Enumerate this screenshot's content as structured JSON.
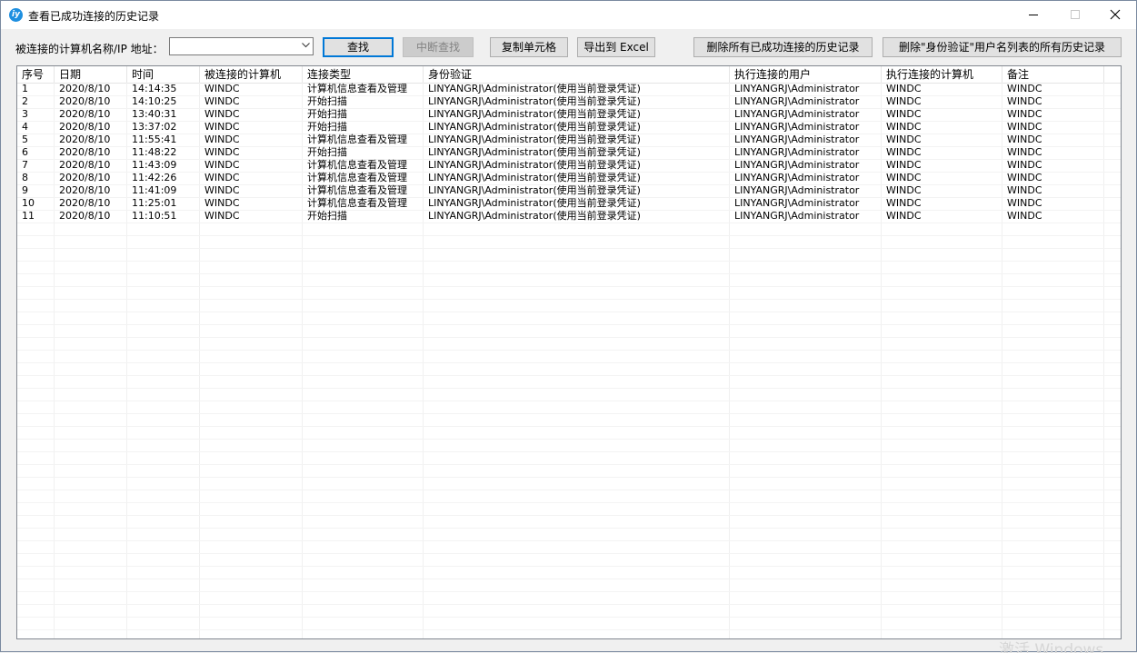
{
  "window": {
    "title": "查看已成功连接的历史记录",
    "icon_glyph": "iy"
  },
  "toolbar": {
    "host_label": "被连接的计算机名称/IP 地址：",
    "host_value": "",
    "search_label": "查找",
    "stop_label": "中断查找",
    "copy_label": "复制单元格",
    "export_label": "导出到 Excel",
    "delete_all_label": "删除所有已成功连接的历史记录",
    "delete_auth_label": "删除\"身份验证\"用户名列表的所有历史记录"
  },
  "grid": {
    "columns": [
      "序号",
      "日期",
      "时间",
      "被连接的计算机",
      "连接类型",
      "身份验证",
      "执行连接的用户",
      "执行连接的计算机",
      "备注"
    ],
    "rows": [
      [
        "1",
        "2020/8/10",
        "14:14:35",
        "WINDC",
        "计算机信息查看及管理",
        "LINYANGRJ\\Administrator(使用当前登录凭证)",
        "LINYANGRJ\\Administrator",
        "WINDC",
        "WINDC"
      ],
      [
        "2",
        "2020/8/10",
        "14:10:25",
        "WINDC",
        "开始扫描",
        "LINYANGRJ\\Administrator(使用当前登录凭证)",
        "LINYANGRJ\\Administrator",
        "WINDC",
        "WINDC"
      ],
      [
        "3",
        "2020/8/10",
        "13:40:31",
        "WINDC",
        "开始扫描",
        "LINYANGRJ\\Administrator(使用当前登录凭证)",
        "LINYANGRJ\\Administrator",
        "WINDC",
        "WINDC"
      ],
      [
        "4",
        "2020/8/10",
        "13:37:02",
        "WINDC",
        "开始扫描",
        "LINYANGRJ\\Administrator(使用当前登录凭证)",
        "LINYANGRJ\\Administrator",
        "WINDC",
        "WINDC"
      ],
      [
        "5",
        "2020/8/10",
        "11:55:41",
        "WINDC",
        "计算机信息查看及管理",
        "LINYANGRJ\\Administrator(使用当前登录凭证)",
        "LINYANGRJ\\Administrator",
        "WINDC",
        "WINDC"
      ],
      [
        "6",
        "2020/8/10",
        "11:48:22",
        "WINDC",
        "开始扫描",
        "LINYANGRJ\\Administrator(使用当前登录凭证)",
        "LINYANGRJ\\Administrator",
        "WINDC",
        "WINDC"
      ],
      [
        "7",
        "2020/8/10",
        "11:43:09",
        "WINDC",
        "计算机信息查看及管理",
        "LINYANGRJ\\Administrator(使用当前登录凭证)",
        "LINYANGRJ\\Administrator",
        "WINDC",
        "WINDC"
      ],
      [
        "8",
        "2020/8/10",
        "11:42:26",
        "WINDC",
        "计算机信息查看及管理",
        "LINYANGRJ\\Administrator(使用当前登录凭证)",
        "LINYANGRJ\\Administrator",
        "WINDC",
        "WINDC"
      ],
      [
        "9",
        "2020/8/10",
        "11:41:09",
        "WINDC",
        "计算机信息查看及管理",
        "LINYANGRJ\\Administrator(使用当前登录凭证)",
        "LINYANGRJ\\Administrator",
        "WINDC",
        "WINDC"
      ],
      [
        "10",
        "2020/8/10",
        "11:25:01",
        "WINDC",
        "计算机信息查看及管理",
        "LINYANGRJ\\Administrator(使用当前登录凭证)",
        "LINYANGRJ\\Administrator",
        "WINDC",
        "WINDC"
      ],
      [
        "11",
        "2020/8/10",
        "11:10:51",
        "WINDC",
        "开始扫描",
        "LINYANGRJ\\Administrator(使用当前登录凭证)",
        "LINYANGRJ\\Administrator",
        "WINDC",
        "WINDC"
      ]
    ]
  },
  "watermark": {
    "text": "激活 Windows"
  },
  "colors": {
    "accent": "#0078d7",
    "app_icon": "#1e8fe0"
  }
}
